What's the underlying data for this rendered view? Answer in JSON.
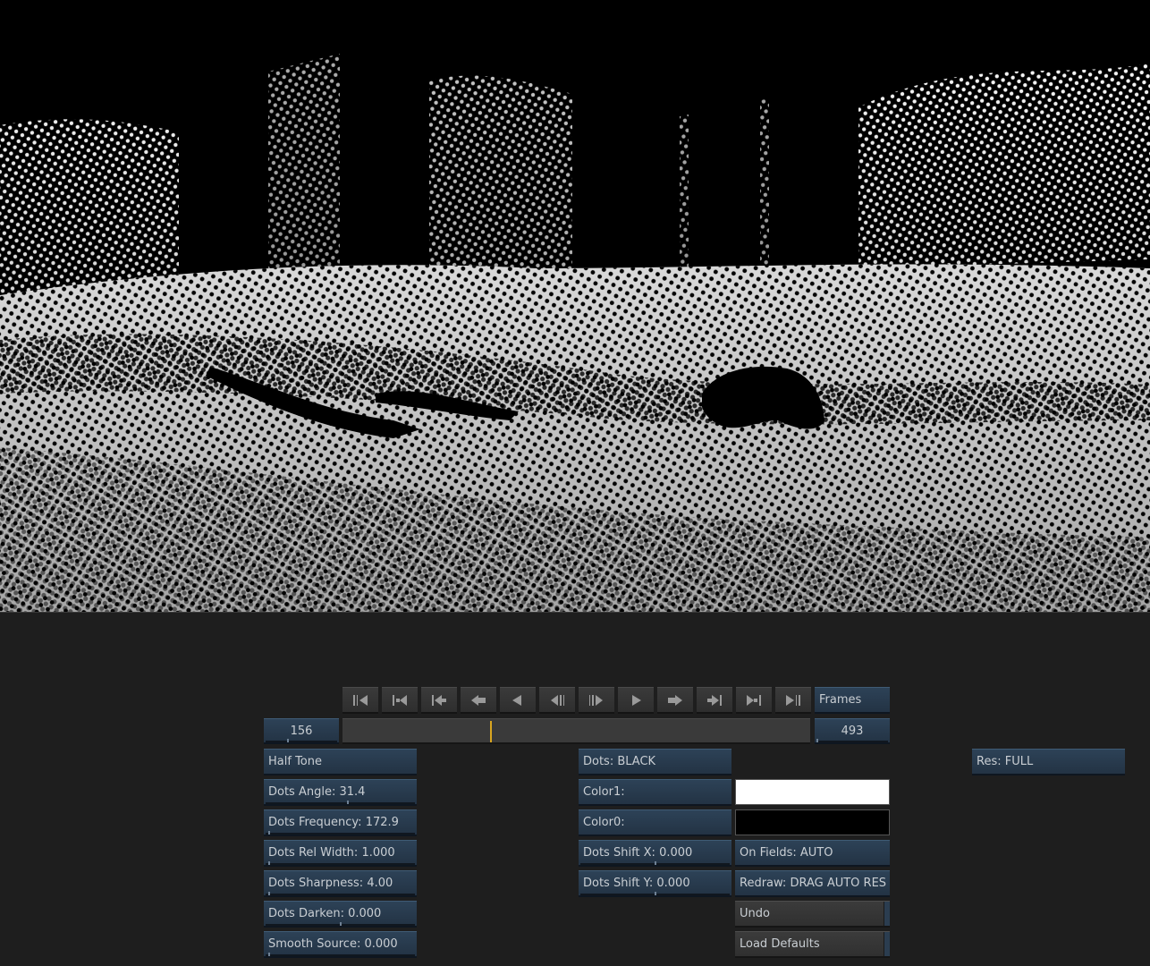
{
  "transport": {
    "buttons": [
      {
        "name": "go-to-start-icon"
      },
      {
        "name": "go-to-in-point-icon"
      },
      {
        "name": "previous-keyframe-icon"
      },
      {
        "name": "step-back-icon"
      },
      {
        "name": "play-reverse-icon"
      },
      {
        "name": "previous-frame-icon"
      },
      {
        "name": "next-frame-icon"
      },
      {
        "name": "play-icon"
      },
      {
        "name": "step-forward-icon"
      },
      {
        "name": "next-keyframe-icon"
      },
      {
        "name": "go-to-out-point-icon"
      },
      {
        "name": "go-to-end-icon"
      }
    ],
    "mode_label": "Frames"
  },
  "timeline": {
    "current_frame": "156",
    "end_frame": "493",
    "playhead_fraction": 0.317
  },
  "left_params": {
    "effect_name": "Half Tone",
    "items": [
      {
        "label": "Dots Angle: 31.4",
        "slider": 0.55
      },
      {
        "label": "Dots Frequency: 172.9",
        "slider": 0.02
      },
      {
        "label": "Dots Rel Width: 1.000",
        "slider": 0.02
      },
      {
        "label": "Dots Sharpness: 4.00",
        "slider": 0.02
      },
      {
        "label": "Dots Darken: 0.000",
        "slider": 0.5
      },
      {
        "label": "Smooth Source: 0.000",
        "slider": 0.02
      }
    ]
  },
  "mid_params": {
    "dots_mode": "Dots: BLACK",
    "color1_label": "Color1:",
    "color1_value": "#ffffff",
    "color0_label": "Color0:",
    "color0_value": "#000000",
    "shift_x": {
      "label": "Dots Shift X: 0.000",
      "slider": 0.5
    },
    "shift_y": {
      "label": "Dots Shift Y: 0.000",
      "slider": 0.5
    }
  },
  "right_controls": {
    "on_fields": "On Fields: AUTO",
    "redraw": "Redraw: DRAG AUTO RES",
    "undo": "Undo",
    "load_defaults": "Load Defaults"
  },
  "res": "Res: FULL",
  "colors": {
    "panel_bg": "#1e1e1e",
    "button_blue": "#2a3d50",
    "playhead": "#d9a520"
  }
}
